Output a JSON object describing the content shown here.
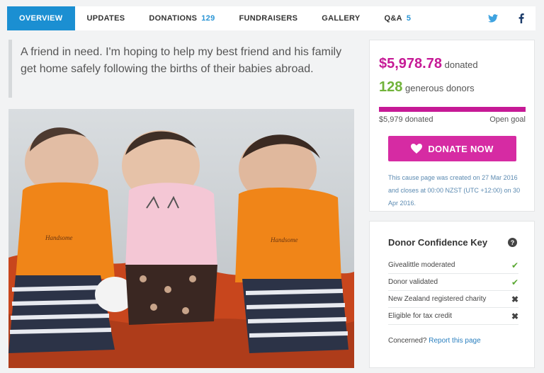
{
  "tabs": {
    "overview": "OVERVIEW",
    "updates": "UPDATES",
    "donations": "DONATIONS",
    "donations_count": "129",
    "fundraisers": "FUNDRAISERS",
    "gallery": "GALLERY",
    "qa": "Q&A",
    "qa_count": "5"
  },
  "social": {
    "twitter_icon": "twitter-bird",
    "facebook_icon": "f"
  },
  "intro_quote": "A friend in need. I'm hoping to help my best friend and his family get home safely following the births of their babies abroad.",
  "summary": {
    "amount": "$5,978.78",
    "amount_suffix": "donated",
    "donor_count": "128",
    "donor_suffix": "generous donors",
    "progress": 1.0,
    "progress_amount_label": "$5,979 donated",
    "goal_label": "Open goal",
    "donate_button": "DONATE NOW",
    "created_note": "This cause page was created on 27 Mar 2016 and closes at 00:00 NZST (UTC +12:00) on 30 Apr 2016."
  },
  "confidence": {
    "title": "Donor Confidence Key",
    "items": [
      {
        "label": "Givealittle moderated",
        "status": "yes"
      },
      {
        "label": "Donor validated",
        "status": "yes"
      },
      {
        "label": "New Zealand registered charity",
        "status": "no"
      },
      {
        "label": "Eligible for tax credit",
        "status": "no"
      }
    ],
    "concern_prefix": "Concerned?",
    "concern_link": "Report this page"
  },
  "colors": {
    "accent_blue": "#1b8fd2",
    "donate_pink": "#d62ba3",
    "amount_pink": "#c61a96",
    "donor_green": "#71b33a"
  }
}
